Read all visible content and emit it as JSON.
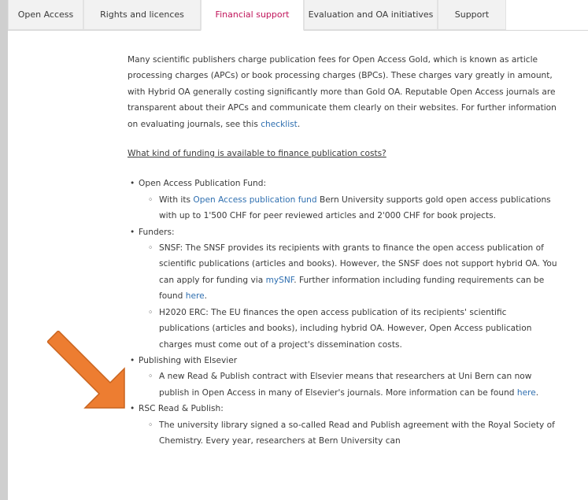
{
  "tabs": [
    {
      "label": "Open Access",
      "active": false
    },
    {
      "label": "Rights and licences",
      "active": false
    },
    {
      "label": "Financial support",
      "active": true
    },
    {
      "label": "Evaluation and OA initiatives",
      "active": false
    },
    {
      "label": "Support",
      "active": false
    }
  ],
  "intro": {
    "text": "Many scientific publishers charge publication fees for Open Access Gold, which is known as article processing charges (APCs) or book processing charges (BPCs). These charges vary greatly in amount, with Hybrid OA generally costing significantly more than Gold OA. Reputable Open Access journals are transparent about their APCs and communicate them clearly on their websites. For further information on evaluating journals, see this",
    "link": "checklist",
    "end": "."
  },
  "question": "What kind of funding is available to finance publication costs?",
  "items": {
    "fund": {
      "title": "Open Access Publication Fund:",
      "sub": {
        "pre": "With its ",
        "link": "Open Access publication fund",
        "post": " Bern University supports gold open access publications with up to 1'500 CHF for peer reviewed articles and 2'000 CHF for book projects."
      }
    },
    "funders": {
      "title": "Funders:",
      "snsf": {
        "pre": "SNSF: The SNSF provides its recipients with grants to finance the open access publication of scientific publications (articles and books). However, the SNSF does not support hybrid OA. You can apply for funding via ",
        "link1": "mySNF",
        "mid": ". Further information including funding requirements can be found ",
        "link2": "here",
        "post": "."
      },
      "h2020": "H2020 ERC: The EU finances the open access publication of its recipients' scientific publications (articles and books), including hybrid OA. However, Open Access publication charges must come out of a project's dissemination costs."
    },
    "elsevier": {
      "title": "Publishing with Elsevier",
      "sub": {
        "pre": "A new Read & Publish contract with Elsevier means that researchers at Uni Bern can now publish in Open Access in many of Elsevier's journals. More information can be found ",
        "link": "here",
        "post": "."
      }
    },
    "rsc": {
      "title": "RSC Read & Publish:",
      "sub": "The university library signed a so-called Read and Publish agreement with the Royal Society of Chemistry. Every year, researchers at Bern University can"
    }
  },
  "colors": {
    "accent": "#c0145a",
    "link": "#2f6fb0",
    "arrow": "#ed7d31"
  }
}
